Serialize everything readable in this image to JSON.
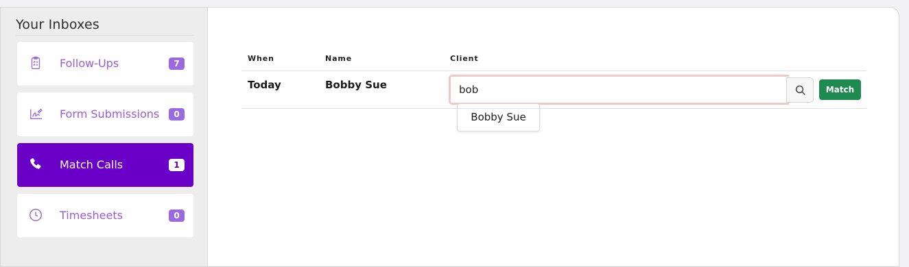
{
  "sidebar": {
    "title": "Your Inboxes",
    "items": [
      {
        "label": "Follow-Ups",
        "count": "7",
        "icon": "clipboard-list-icon",
        "active": false
      },
      {
        "label": "Form Submissions",
        "count": "0",
        "icon": "signature-icon",
        "active": false
      },
      {
        "label": "Match Calls",
        "count": "1",
        "icon": "phone-icon",
        "active": true
      },
      {
        "label": "Timesheets",
        "count": "0",
        "icon": "clock-icon",
        "active": false
      }
    ]
  },
  "table": {
    "headers": {
      "when": "When",
      "name": "Name",
      "client": "Client"
    },
    "row": {
      "when": "Today",
      "name": "Bobby Sue",
      "client_input_value": "bob",
      "suggestion": "Bobby Sue",
      "match_label": "Match"
    }
  },
  "colors": {
    "accent": "#6a00c8",
    "badge": "#9b6ae0",
    "match_green": "#1e8a4f",
    "input_error_border": "#f0c8ca"
  }
}
